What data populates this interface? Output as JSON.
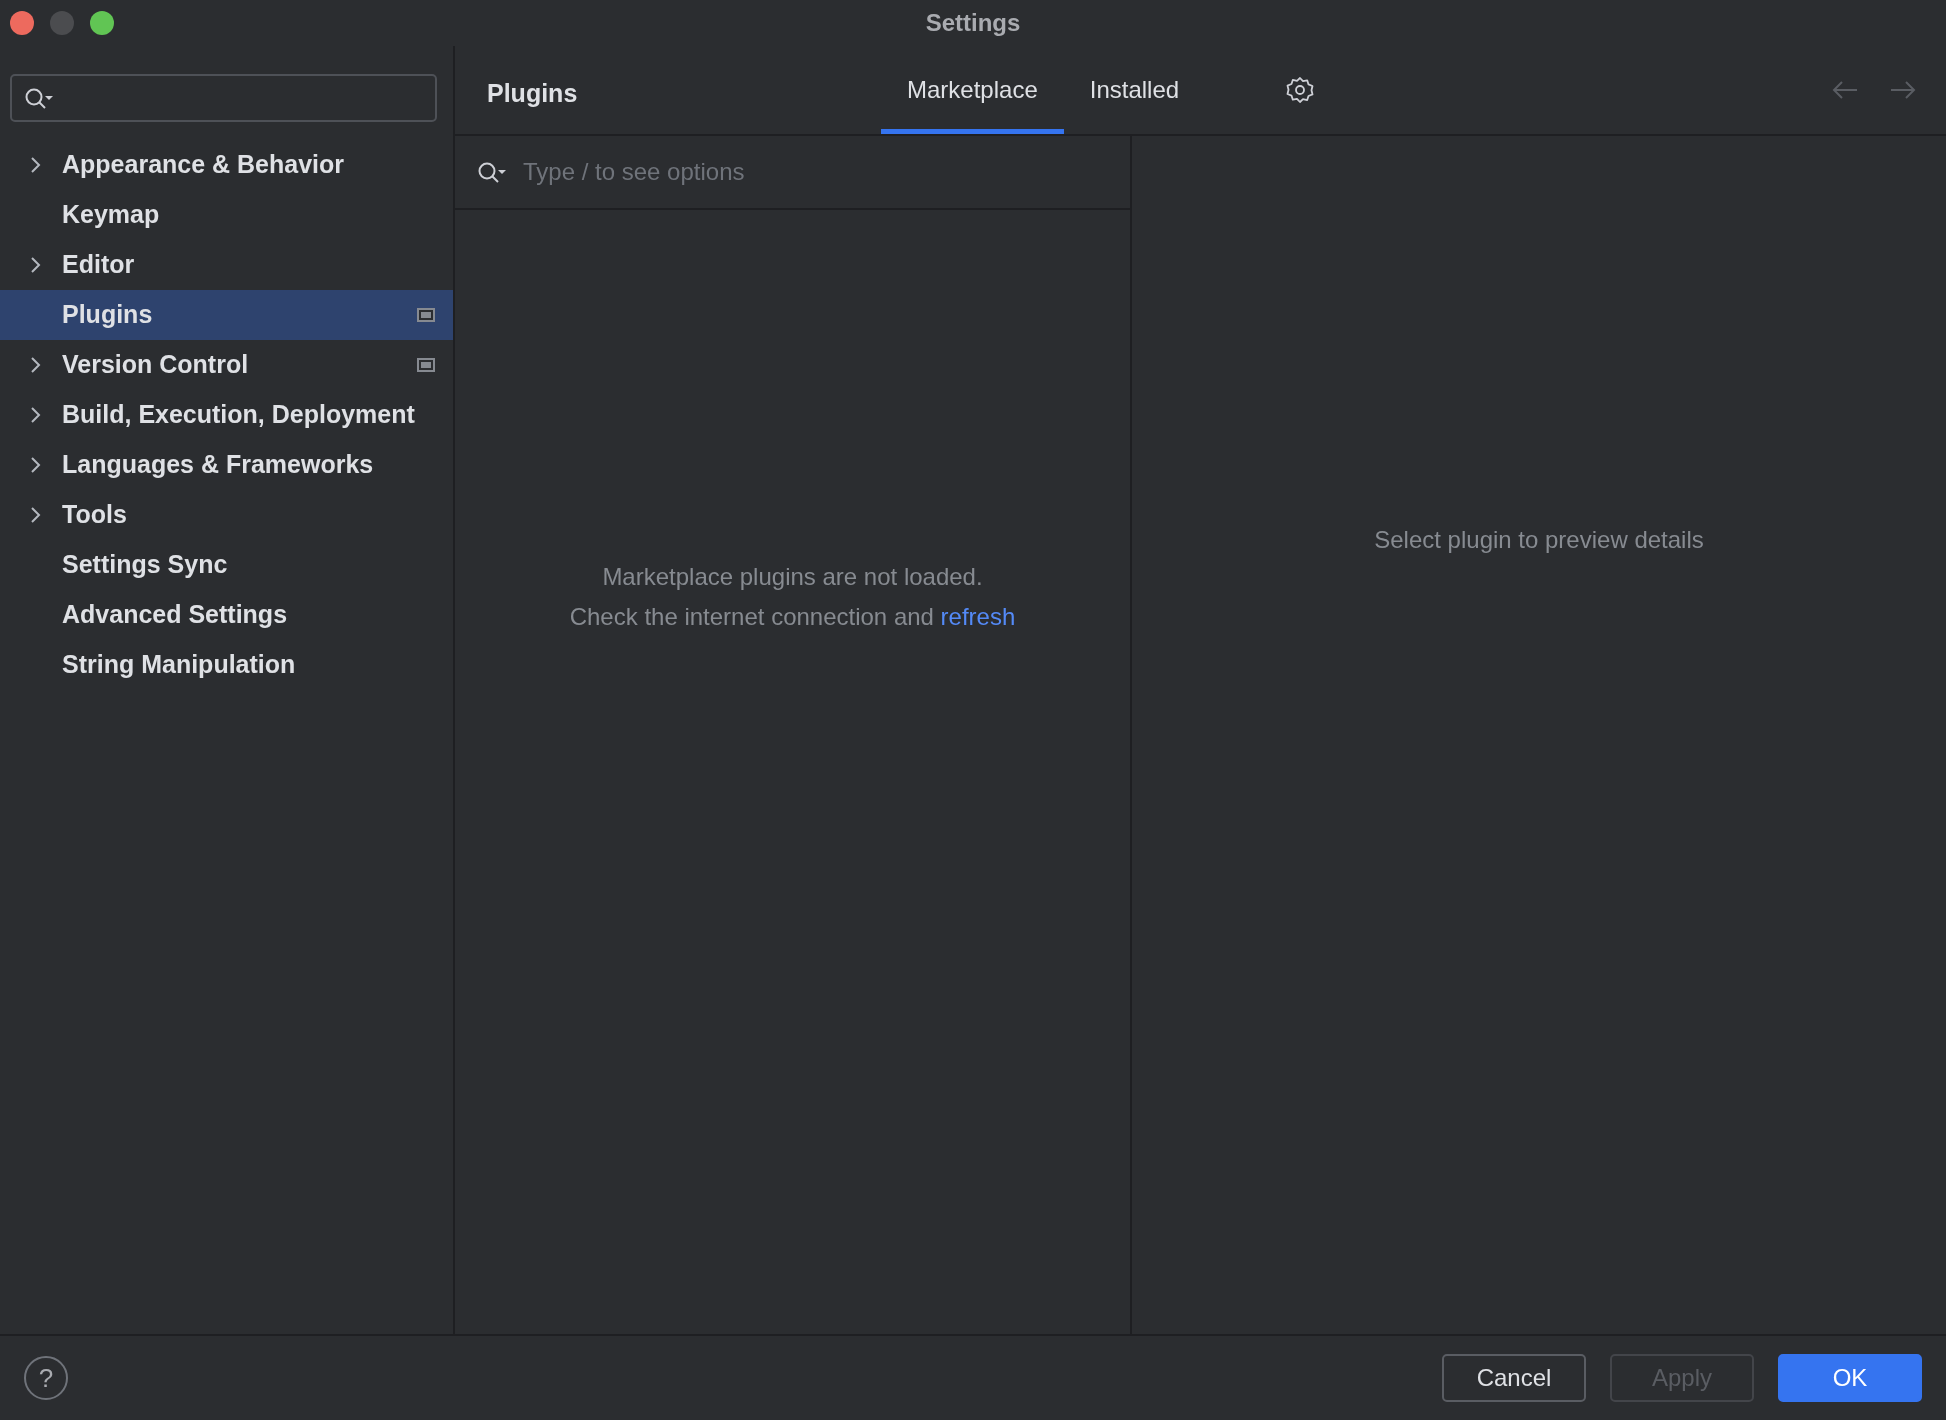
{
  "window": {
    "title": "Settings"
  },
  "sidebar": {
    "items": [
      {
        "label": "Appearance & Behavior",
        "expandable": true,
        "selected": false,
        "project_icon": false
      },
      {
        "label": "Keymap",
        "expandable": false,
        "selected": false,
        "project_icon": false
      },
      {
        "label": "Editor",
        "expandable": true,
        "selected": false,
        "project_icon": false
      },
      {
        "label": "Plugins",
        "expandable": false,
        "selected": true,
        "project_icon": true
      },
      {
        "label": "Version Control",
        "expandable": true,
        "selected": false,
        "project_icon": true
      },
      {
        "label": "Build, Execution, Deployment",
        "expandable": true,
        "selected": false,
        "project_icon": false
      },
      {
        "label": "Languages & Frameworks",
        "expandable": true,
        "selected": false,
        "project_icon": false
      },
      {
        "label": "Tools",
        "expandable": true,
        "selected": false,
        "project_icon": false
      },
      {
        "label": "Settings Sync",
        "expandable": false,
        "selected": false,
        "project_icon": false
      },
      {
        "label": "Advanced Settings",
        "expandable": false,
        "selected": false,
        "project_icon": false
      },
      {
        "label": "String Manipulation",
        "expandable": false,
        "selected": false,
        "project_icon": false
      }
    ]
  },
  "header": {
    "title": "Plugins",
    "tabs": [
      {
        "label": "Marketplace",
        "selected": true
      },
      {
        "label": "Installed",
        "selected": false
      }
    ],
    "nav": [
      {
        "kind": "back",
        "disabled": true
      },
      {
        "kind": "forward",
        "disabled": true
      }
    ]
  },
  "plugin_list": {
    "search": {
      "placeholder": "Type / to see options"
    },
    "message": "Marketplace plugins are not loaded.",
    "hint": "Check the internet connection and",
    "link": "refresh"
  },
  "details": {
    "message": "Select plugin to preview details"
  },
  "footer": {
    "help": "?",
    "buttons": [
      {
        "label": "Cancel",
        "kind": "secondary",
        "disabled": false
      },
      {
        "label": "Apply",
        "kind": "secondary",
        "disabled": true
      },
      {
        "label": "OK",
        "kind": "primary",
        "disabled": false
      }
    ]
  }
}
